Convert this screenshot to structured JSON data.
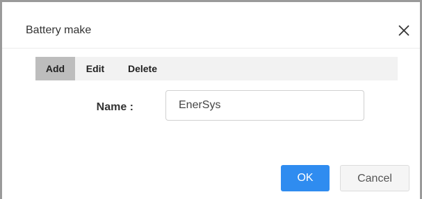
{
  "dialog": {
    "title": "Battery make",
    "close_icon": "close-icon"
  },
  "toolbar": {
    "items": [
      {
        "label": "Add",
        "active": true
      },
      {
        "label": "Edit",
        "active": false
      },
      {
        "label": "Delete",
        "active": false
      }
    ]
  },
  "form": {
    "name_label": "Name :",
    "name_value": "EnerSys"
  },
  "footer": {
    "ok_label": "OK",
    "cancel_label": "Cancel"
  },
  "colors": {
    "primary": "#2f8cf0",
    "toolbar_bg": "#f2f2f2",
    "active_tab": "#bdbdbd"
  }
}
